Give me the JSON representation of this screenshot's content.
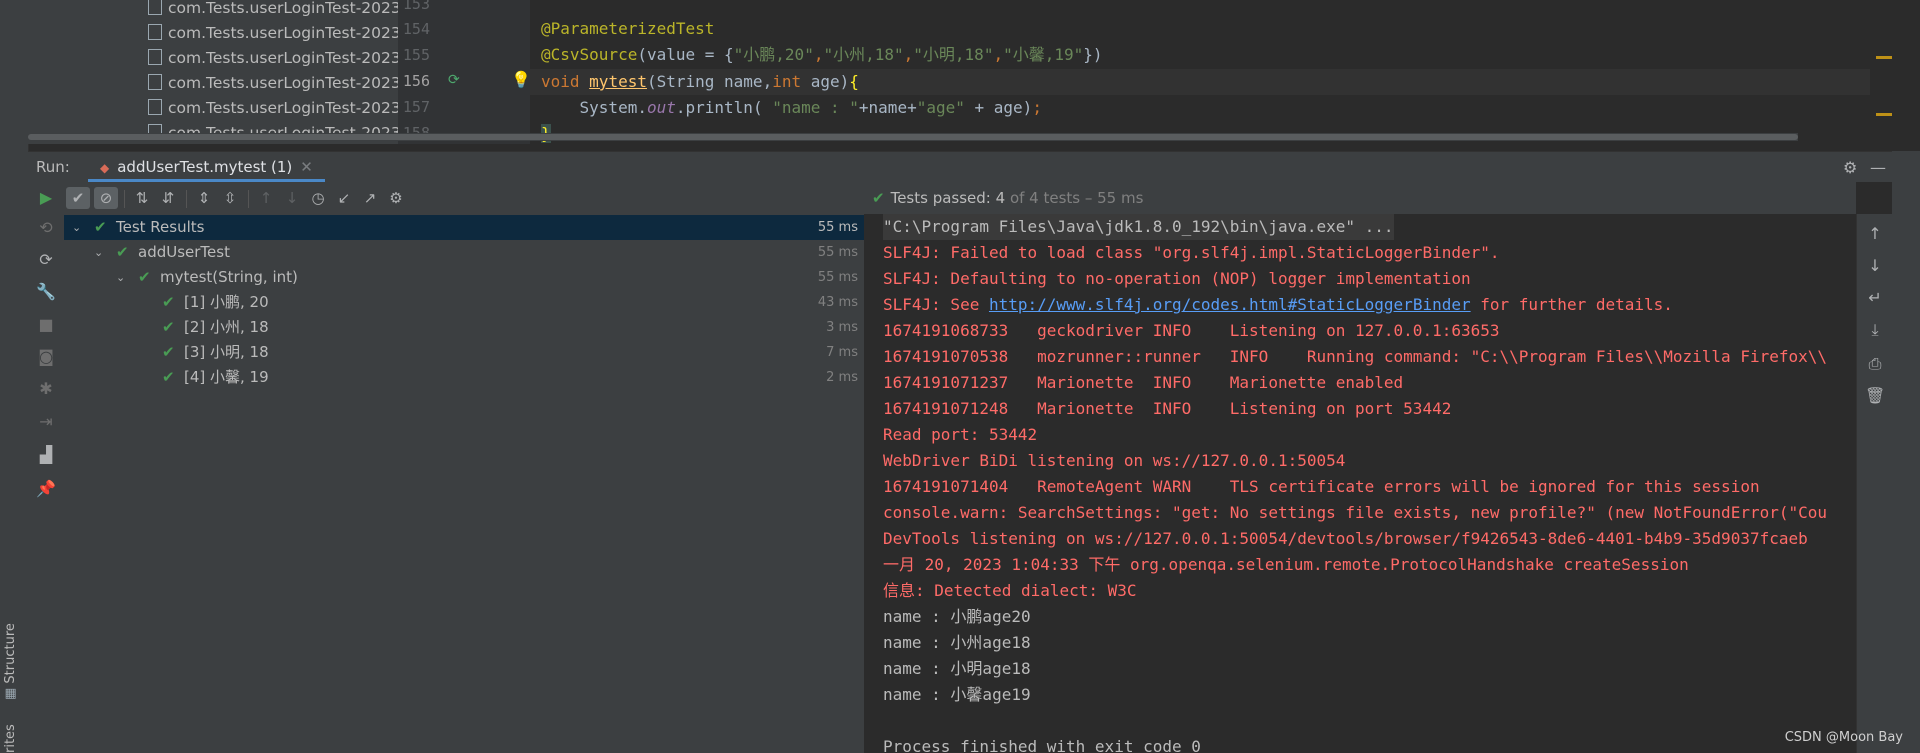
{
  "left_strip": {
    "structure": "Structure",
    "favorites": "rites"
  },
  "project_tree": [
    "com.Tests.userLoginTest-2023",
    "com.Tests.userLoginTest-2023",
    "com.Tests.userLoginTest-2023",
    "com.Tests.userLoginTest-2023",
    "com.Tests.userLoginTest-2023",
    "com.Tests.userLoginTest-2023"
  ],
  "editor": {
    "line_numbers": [
      "153",
      "154",
      "155",
      "156",
      "157",
      "158"
    ],
    "lines": {
      "l154": "@ParameterizedTest",
      "l155_ann": "@CsvSource",
      "l155_open": "(value = {",
      "l155_s1": "\"小鹏,20\"",
      "l155_s2": "\"小州,18\"",
      "l155_s3": "\"小明,18\"",
      "l155_s4": "\"小馨,19\"",
      "l155_close": "})",
      "comma": ",",
      "l156_void": "void ",
      "l156_name": "mytest",
      "l156_p1": "(String name,",
      "l156_int": "int",
      "l156_p2": " age)",
      "l156_brace": "{",
      "l157_a": "    System.",
      "l157_out": "out",
      "l157_b": ".println( ",
      "l157_s1": "\"name : \"",
      "l157_c": "+name+",
      "l157_s2": "\"age\"",
      "l157_d": " + age)",
      "l157_semi": ";",
      "l158": "}"
    }
  },
  "run": {
    "label": "Run:",
    "tab": "addUserTest.mytest (1)",
    "status_check": "✔",
    "status_prefix": "Tests passed: ",
    "status_count": "4",
    "status_suffix": " of 4 tests – 55 ms"
  },
  "tree": [
    {
      "label": "Test Results",
      "dur": "55 ms"
    },
    {
      "label": "addUserTest",
      "dur": "55 ms"
    },
    {
      "label": "mytest(String, int)",
      "dur": "55 ms"
    },
    {
      "label": "[1] 小鹏, 20",
      "dur": "43 ms"
    },
    {
      "label": "[2] 小州, 18",
      "dur": "3 ms"
    },
    {
      "label": "[3] 小明, 18",
      "dur": "7 ms"
    },
    {
      "label": "[4] 小馨, 19",
      "dur": "2 ms"
    }
  ],
  "console": {
    "cmd": "\"C:\\Program Files\\Java\\jdk1.8.0_192\\bin\\java.exe\" ...",
    "l1": "SLF4J: Failed to load class \"org.slf4j.impl.StaticLoggerBinder\".",
    "l2": "SLF4J: Defaulting to no-operation (NOP) logger implementation",
    "l3_pre": "SLF4J: See ",
    "l3_link": "http://www.slf4j.org/codes.html#StaticLoggerBinder",
    "l3_post": " for further details.",
    "l4": "1674191068733   geckodriver INFO    Listening on 127.0.0.1:63653",
    "l5": "1674191070538   mozrunner::runner   INFO    Running command: \"C:\\\\Program Files\\\\Mozilla Firefox\\\\",
    "l6": "1674191071237   Marionette  INFO    Marionette enabled",
    "l7": "1674191071248   Marionette  INFO    Listening on port 53442",
    "l8": "Read port: 53442",
    "l9": "WebDriver BiDi listening on ws://127.0.0.1:50054",
    "l10": "1674191071404   RemoteAgent WARN    TLS certificate errors will be ignored for this session",
    "l11": "console.warn: SearchSettings: \"get: No settings file exists, new profile?\" (new NotFoundError(\"Cou",
    "l12": "DevTools listening on ws://127.0.0.1:50054/devtools/browser/f9426543-8de6-4401-b4b9-35d9037fcaeb",
    "l13": "一月 20, 2023 1:04:33 下午 org.openqa.selenium.remote.ProtocolHandshake createSession",
    "l14": "信息: Detected dialect: W3C",
    "o1": "name : 小鹏age20",
    "o2": "name : 小州age18",
    "o3": "name : 小明age18",
    "o4": "name : 小馨age19",
    "exit": "Process finished with exit code 0"
  },
  "watermark": "CSDN @Moon Bay",
  "colors": {
    "pass": "#499c54",
    "error": "#ff6b68",
    "accent": "#4a88c7",
    "selection": "#0d293e"
  }
}
